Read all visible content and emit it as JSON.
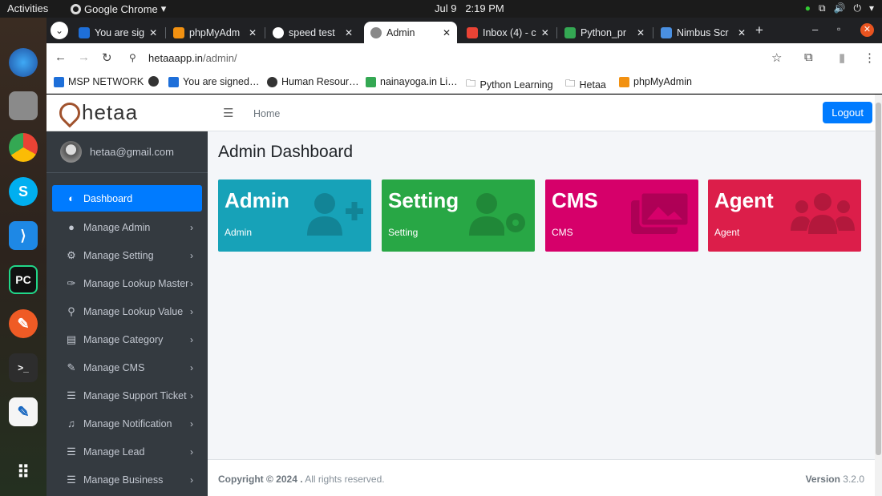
{
  "os": {
    "activities": "Activities",
    "app_name": "Google Chrome",
    "clock_date": "Jul 9",
    "clock_time": "2:19 PM"
  },
  "tabs": [
    {
      "label": "You are sig",
      "fav_color": "#1e6fd9"
    },
    {
      "label": "phpMyAdm",
      "fav_color": "#f29111"
    },
    {
      "label": "speed test",
      "fav_color": "#ffffff"
    },
    {
      "label": "Admin",
      "fav_color": "#888888"
    },
    {
      "label": "Inbox (4) - c",
      "fav_color": "#ea4335"
    },
    {
      "label": "Python_pr",
      "fav_color": "#34a853"
    },
    {
      "label": "Nimbus Scr",
      "fav_color": "#4a90e2"
    }
  ],
  "address": {
    "host": "hetaaapp.in",
    "path": "/admin/"
  },
  "bookmarks": [
    {
      "label": "MSP NETWORK",
      "color": "#1e6fd9"
    },
    {
      "label": "",
      "color": "#444444"
    },
    {
      "label": "You are signed…",
      "color": "#1e6fd9"
    },
    {
      "label": "Human Resour…",
      "color": "#333333"
    },
    {
      "label": "nainayoga.in Li…",
      "color": "#34a853"
    },
    {
      "label": "Python Learning",
      "color": "#555555"
    },
    {
      "label": "Hetaa",
      "color": "#555555"
    },
    {
      "label": "phpMyAdmin",
      "color": "#f29111"
    }
  ],
  "brand": {
    "name": "hetaa"
  },
  "user": {
    "email": "hetaa@gmail.com"
  },
  "menu": [
    {
      "label": "Dashboard",
      "icon": "dashboard-icon",
      "glyph": "◐",
      "active": true
    },
    {
      "label": "Manage Admin",
      "icon": "user-icon",
      "glyph": "👤"
    },
    {
      "label": "Manage Setting",
      "icon": "gear-icon",
      "glyph": "⚙"
    },
    {
      "label": "Manage Lookup Master",
      "icon": "wrench-icon",
      "glyph": "🔧"
    },
    {
      "label": "Manage Lookup Value",
      "icon": "search-icon",
      "glyph": "🔍"
    },
    {
      "label": "Manage Category",
      "icon": "list-icon",
      "glyph": "▤"
    },
    {
      "label": "Manage CMS",
      "icon": "edit-icon",
      "glyph": "✎"
    },
    {
      "label": "Manage Support Ticket",
      "icon": "list-icon",
      "glyph": "☰"
    },
    {
      "label": "Manage Notification",
      "icon": "bell-icon",
      "glyph": "🔔"
    },
    {
      "label": "Manage Lead",
      "icon": "list-icon",
      "glyph": "☰"
    },
    {
      "label": "Manage Business",
      "icon": "list-icon",
      "glyph": "☰"
    }
  ],
  "navbar": {
    "home": "Home",
    "logout": "Logout"
  },
  "page_title": "Admin Dashboard",
  "cards": [
    {
      "title": "Admin",
      "subtitle": "Admin",
      "color": "#17a2b8",
      "icon": "user-plus-icon"
    },
    {
      "title": "Setting",
      "subtitle": "Setting",
      "color": "#28a745",
      "icon": "user-gear-icon"
    },
    {
      "title": "CMS",
      "subtitle": "CMS",
      "color": "#d6006a",
      "icon": "images-icon"
    },
    {
      "title": "Agent",
      "subtitle": "Agent",
      "color": "#dc1e4a",
      "icon": "users-icon"
    }
  ],
  "footer": {
    "copyright_bold": "Copyright © 2024 .",
    "copyright_rest": "All rights reserved.",
    "version_label": "Version",
    "version_value": "3.2.0"
  }
}
